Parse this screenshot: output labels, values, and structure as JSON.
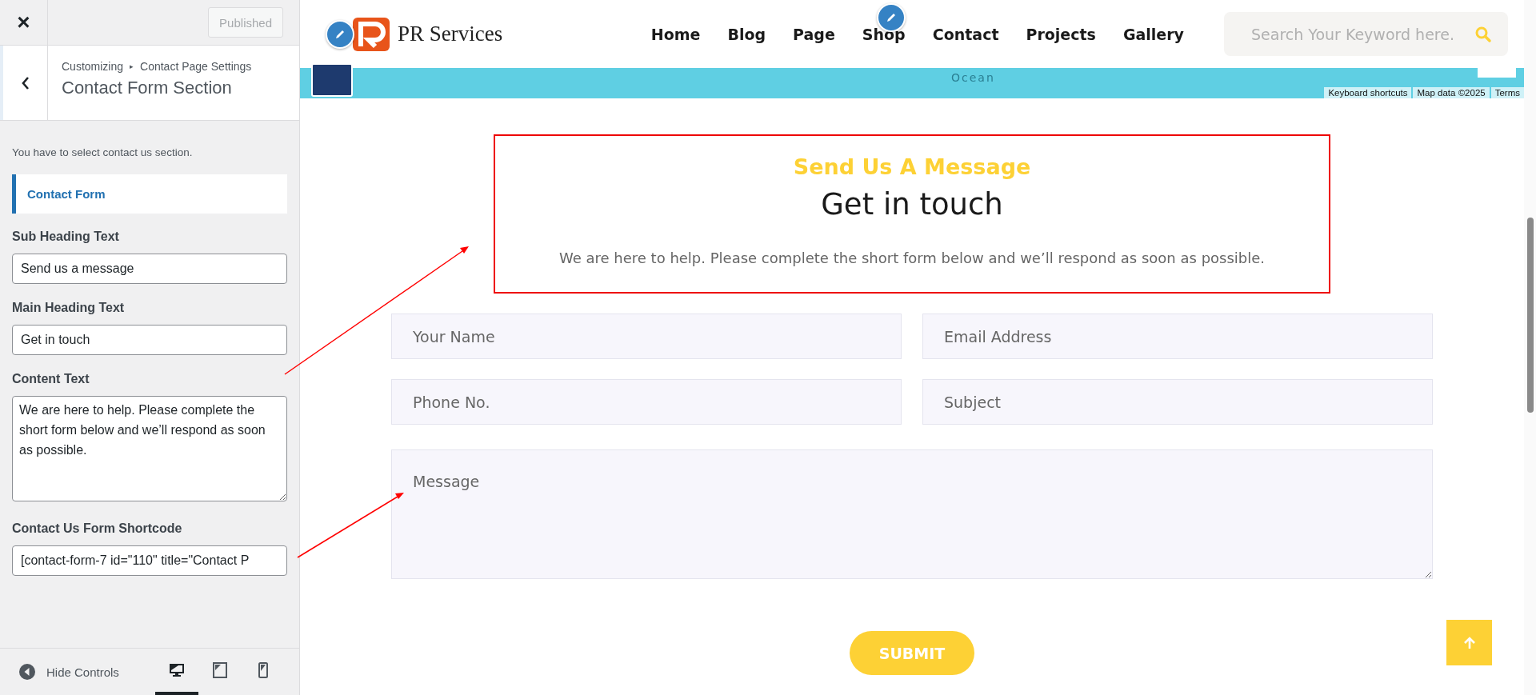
{
  "customizer": {
    "close": "×",
    "publish_button": {
      "label": "Published",
      "disabled": true
    },
    "breadcrumb": [
      "Customizing",
      "Contact Page Settings"
    ],
    "breadcrumb_separator": "▸",
    "section_title": "Contact Form Section",
    "description": "You have to select contact us section.",
    "group_heading": "Contact Form",
    "fields": [
      {
        "kind": "input",
        "label": "Sub Heading Text",
        "value": "Send us a message"
      },
      {
        "kind": "input",
        "label": "Main Heading Text",
        "value": "Get in touch"
      },
      {
        "kind": "textarea",
        "label": "Content Text",
        "value": "We are here to help. Please complete the short form below and we’ll respond as soon as possible."
      },
      {
        "kind": "input",
        "label": "Contact Us Form Shortcode",
        "value": "[contact-form-7 id=\"110\" title=\"Contact P"
      }
    ],
    "footer": {
      "hide_label": "Hide Controls",
      "devices": [
        {
          "kind": "desktop",
          "selected": true
        },
        {
          "kind": "tablet",
          "selected": false
        },
        {
          "kind": "mobile",
          "selected": false
        }
      ]
    }
  },
  "site": {
    "logo_text": "PR Services",
    "nav": [
      "Home",
      "Blog",
      "Page",
      "Shop",
      "Contact",
      "Projects",
      "Gallery"
    ],
    "search": {
      "placeholder": "Search Your Keyword here."
    },
    "map": {
      "label": "Ocean",
      "attribution": [
        "Keyboard shortcuts",
        "Map data ©2025",
        "Terms"
      ]
    },
    "section": {
      "subheading": "Send Us A Message",
      "heading": "Get in touch",
      "text": "We are here to help. Please complete the short form below and we’ll respond as soon as possible."
    },
    "form": {
      "fields": [
        {
          "placeholder": "Your Name"
        },
        {
          "placeholder": "Email Address"
        },
        {
          "placeholder": "Phone No."
        },
        {
          "placeholder": "Subject"
        }
      ],
      "message": {
        "placeholder": "Message"
      },
      "submit": "SUBMIT"
    }
  }
}
